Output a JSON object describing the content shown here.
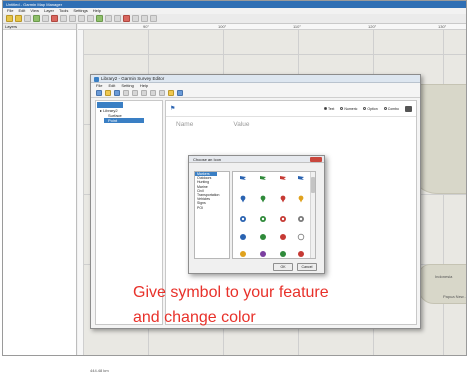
{
  "app": {
    "title": "Untitled - Garmin Map Manager",
    "menu": [
      "File",
      "Edit",
      "View",
      "Layer",
      "Tools",
      "Settings",
      "Help"
    ],
    "left_panel_label": "Layers"
  },
  "map": {
    "ruler_labels": [
      "90°",
      "100°",
      "110°",
      "120°",
      "130°"
    ],
    "place_labels": [
      "Indonesia",
      "Papua New..."
    ],
    "scale_label": "444.48 km"
  },
  "library_editor": {
    "title": "Library2 - Garmin Survey Editor",
    "menu": [
      "File",
      "Edit",
      "Setting",
      "Help"
    ],
    "tree": {
      "root": "Library2",
      "children": [
        "Surface",
        "Point"
      ]
    },
    "radio_options": [
      "Text",
      "Numeric",
      "Option",
      "Combo"
    ],
    "columns": [
      "Name",
      "Value"
    ]
  },
  "icon_dialog": {
    "title": "Choose an Icon",
    "categories": [
      "Markers",
      "Outdoors",
      "Hunting",
      "Marine",
      "Civil",
      "Transportation",
      "Vehicles",
      "Signs",
      "POI"
    ],
    "ok_label": "OK",
    "cancel_label": "Cancel"
  },
  "caption": {
    "line1": "Give symbol to your feature",
    "line2": "and change  color"
  },
  "colors": {
    "caption": "#e8312a",
    "selection": "#3a7fc4",
    "map_background": "#e9e8e3"
  }
}
